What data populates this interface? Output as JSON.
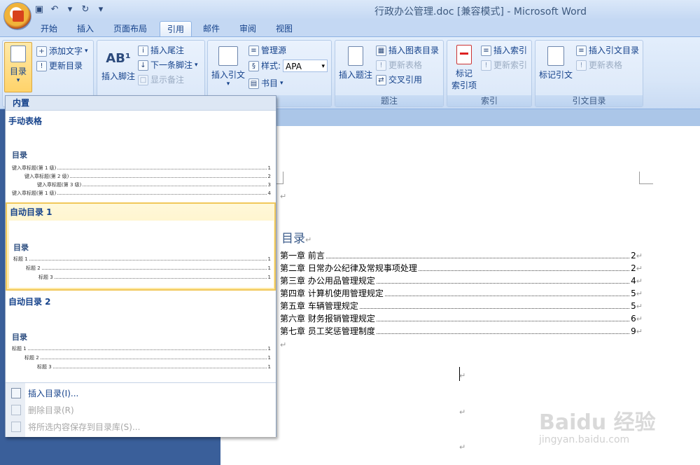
{
  "window": {
    "title": "行政办公管理.doc [兼容模式] - Microsoft Word"
  },
  "tabs": [
    {
      "label": "开始"
    },
    {
      "label": "插入"
    },
    {
      "label": "页面布局"
    },
    {
      "label": "引用",
      "active": true
    },
    {
      "label": "邮件"
    },
    {
      "label": "审阅"
    },
    {
      "label": "视图"
    }
  ],
  "ribbon": {
    "toc_group": {
      "toc_button": "目录",
      "add_text": "添加文字",
      "update_toc": "更新目录"
    },
    "footnote_group": {
      "insert_footnote": "插入脚注",
      "insert_endnote": "插入尾注",
      "next_footnote": "下一条脚注",
      "show_notes": "显示备注"
    },
    "citation_group": {
      "insert_citation": "插入引文",
      "manage_sources": "管理源",
      "style_label": "样式:",
      "style_value": "APA",
      "bibliography": "书目",
      "label": "书目"
    },
    "caption_group": {
      "insert_caption": "插入题注",
      "insert_table_of_figures": "插入图表目录",
      "update_table": "更新表格",
      "cross_reference": "交叉引用",
      "label": "题注"
    },
    "index_group": {
      "mark_entry_line1": "标记",
      "mark_entry_line2": "索引项",
      "insert_index": "插入索引",
      "update_index": "更新索引",
      "label": "索引"
    },
    "authorities_group": {
      "mark_citation": "标记引文",
      "insert_toa": "插入引文目录",
      "update_table": "更新表格",
      "label": "引文目录"
    }
  },
  "dropdown": {
    "header": "内置",
    "sections": [
      {
        "title": "手动表格",
        "preview_title": "目录",
        "lines": [
          {
            "text": "键入章标题(第 1 级)",
            "page": "1"
          },
          {
            "text": "键入章标题(第 2 级)",
            "page": "2"
          },
          {
            "text": "键入章标题(第 3 级)",
            "page": "3"
          },
          {
            "text": "键入章标题(第 1 级)",
            "page": "4"
          }
        ]
      },
      {
        "title": "自动目录 1",
        "preview_title": "目录",
        "lines": [
          {
            "text": "标题 1",
            "page": "1"
          },
          {
            "text": "标题 2",
            "page": "1"
          },
          {
            "text": "标题 3",
            "page": "1"
          }
        ]
      },
      {
        "title": "自动目录 2",
        "preview_title": "目录",
        "lines": [
          {
            "text": "标题 1",
            "page": "1"
          },
          {
            "text": "标题 2",
            "page": "1"
          },
          {
            "text": "标题 3",
            "page": "1"
          }
        ]
      }
    ],
    "menu": [
      {
        "label": "插入目录(I)...",
        "enabled": true
      },
      {
        "label": "删除目录(R)",
        "enabled": false
      },
      {
        "label": "将所选内容保存到目录库(S)...",
        "enabled": false
      }
    ]
  },
  "document": {
    "toc_title": "目录",
    "entries": [
      {
        "chapter": "第一章",
        "title": "前言",
        "page": "2"
      },
      {
        "chapter": "第二章",
        "title": "日常办公纪律及常规事项处理",
        "page": "2"
      },
      {
        "chapter": "第三章",
        "title": "办公用品管理规定",
        "page": "4"
      },
      {
        "chapter": "第四章",
        "title": "计算机使用管理规定",
        "page": "5"
      },
      {
        "chapter": "第五章",
        "title": "车辆管理规定",
        "page": "5"
      },
      {
        "chapter": "第六章",
        "title": "财务报销管理规定",
        "page": "6"
      },
      {
        "chapter": "第七章",
        "title": "员工奖惩管理制度",
        "page": "9"
      }
    ],
    "paragraph_mark": "↵"
  },
  "watermark": {
    "brand": "Baidu 经验",
    "url": "jingyan.baidu.com"
  },
  "colors": {
    "ribbon_bg": "#d8e6f8",
    "highlight": "#ffeaa8",
    "text": "#15428b"
  }
}
